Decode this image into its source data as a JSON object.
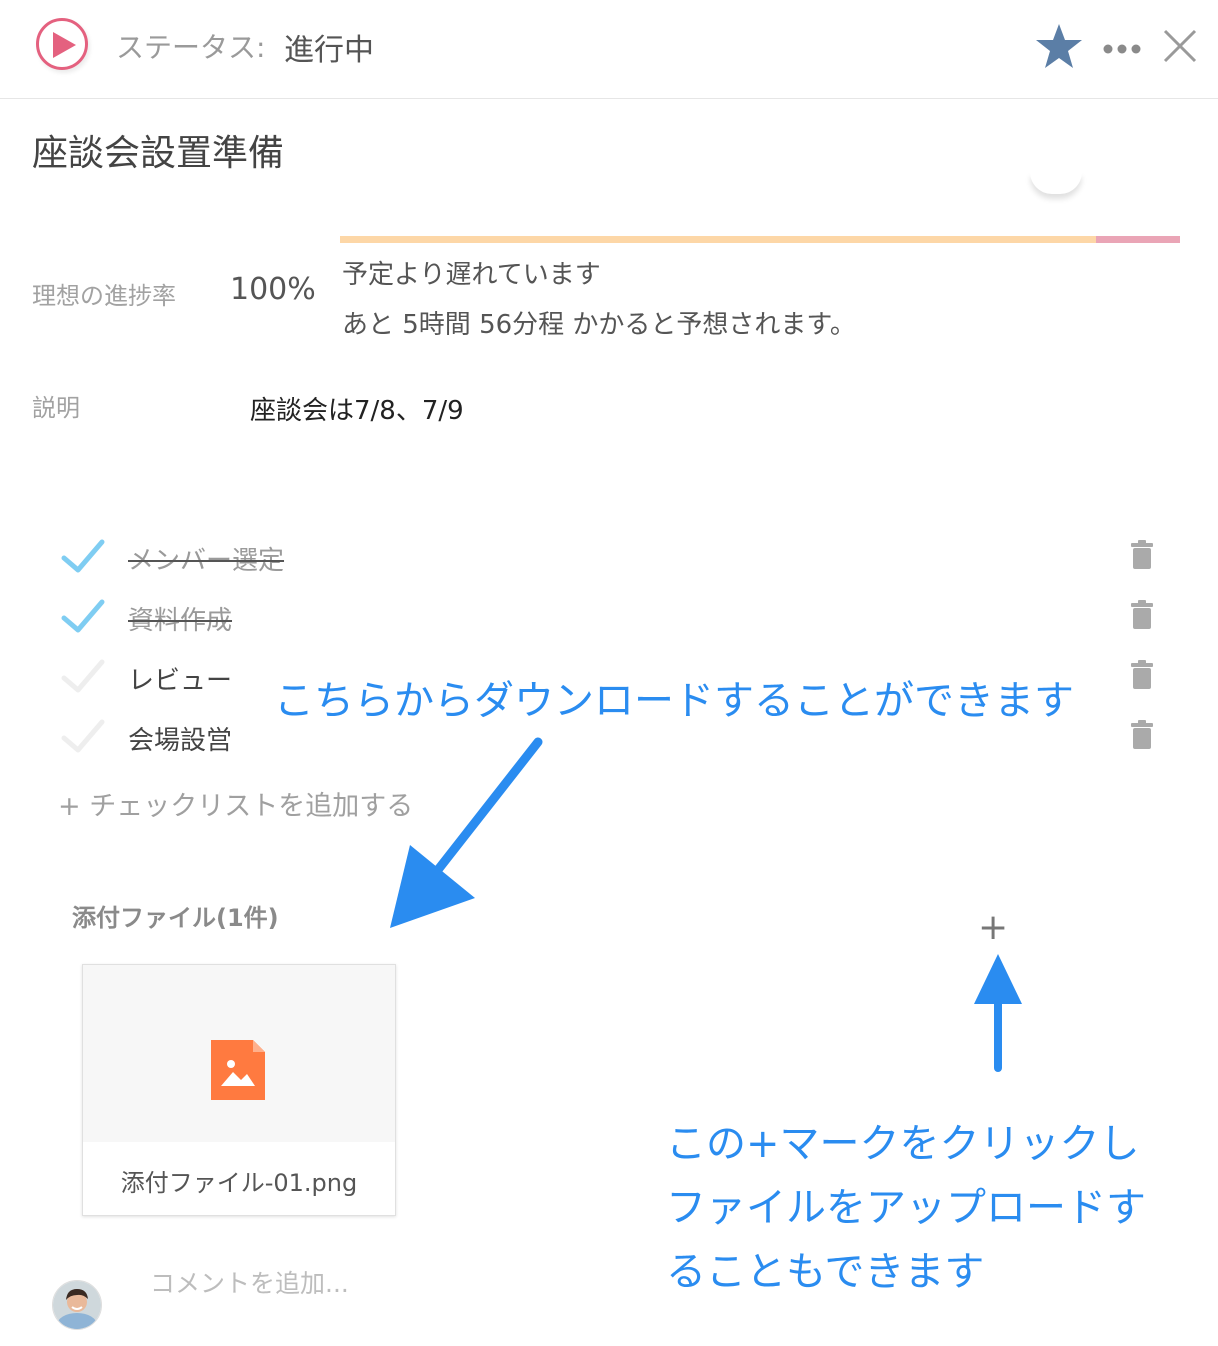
{
  "header": {
    "status_label": "ステータス:",
    "status_value": "進行中",
    "star_color": "#5b7ea6",
    "play_color": "#e4617f"
  },
  "task": {
    "title": "座談会設置準備"
  },
  "progress": {
    "ideal_label": "理想の進捗率",
    "ideal_value": "100%",
    "delay_message": "予定より遅れています",
    "eta_message": "あと 5時間 56分程 かかると予想されます。",
    "track_color": "#fdd7a7",
    "overrun_color": "#eaa5b6"
  },
  "description": {
    "label": "説明",
    "value": "座談会は7/8、7/9"
  },
  "checklist": {
    "items": [
      {
        "label": "メンバー選定",
        "done": true
      },
      {
        "label": "資料作成",
        "done": true
      },
      {
        "label": "レビュー",
        "done": false
      },
      {
        "label": "会場設営",
        "done": false
      }
    ],
    "add_label": "+ チェックリストを追加する"
  },
  "attachments": {
    "header": "添付ファイル(1件)",
    "files": [
      {
        "name": "添付ファイル-01.png",
        "icon": "image-file-icon"
      }
    ],
    "add_label": "+"
  },
  "comment": {
    "placeholder": "コメントを追加..."
  },
  "annotations": {
    "download": "こちらからダウンロードすることができます",
    "upload_lines": [
      "この+マークをクリックし",
      "ファイルをアップロードす",
      "ることもできます"
    ],
    "color": "#2a8cf0"
  }
}
